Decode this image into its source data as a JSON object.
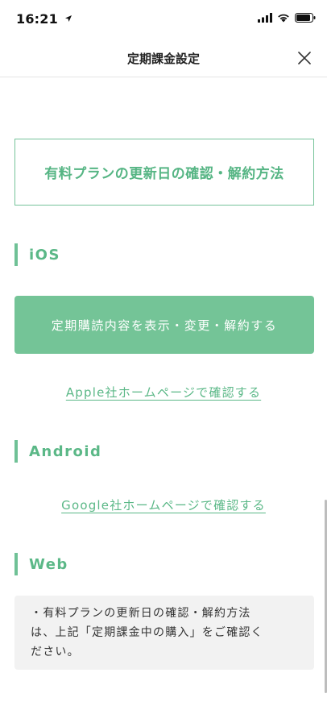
{
  "status_bar": {
    "time": "16:21",
    "location_icon": "location-arrow-icon",
    "signal_icon": "cellular-signal-icon",
    "wifi_icon": "wifi-icon",
    "battery_icon": "battery-icon"
  },
  "nav": {
    "title": "定期課金設定",
    "close_icon": "close-icon"
  },
  "plan_button": {
    "label": "有料プランの更新日の確認・解約方法"
  },
  "ios": {
    "heading": "iOS",
    "manage_button": "定期購読内容を表示・変更・解約する",
    "link": "Apple社ホームページで確認する"
  },
  "android": {
    "heading": "Android",
    "link": "Google社ホームページで確認する"
  },
  "web": {
    "heading": "Web",
    "notice_line1": "・有料プランの更新日の確認・解約方法",
    "notice_line2": "は、上記「定期課金中の購入」をご確認く",
    "notice_line3": "ださい。"
  },
  "colors": {
    "accent": "#74c497",
    "accent_text": "#5bb887",
    "notice_bg": "#f2f2f2"
  }
}
